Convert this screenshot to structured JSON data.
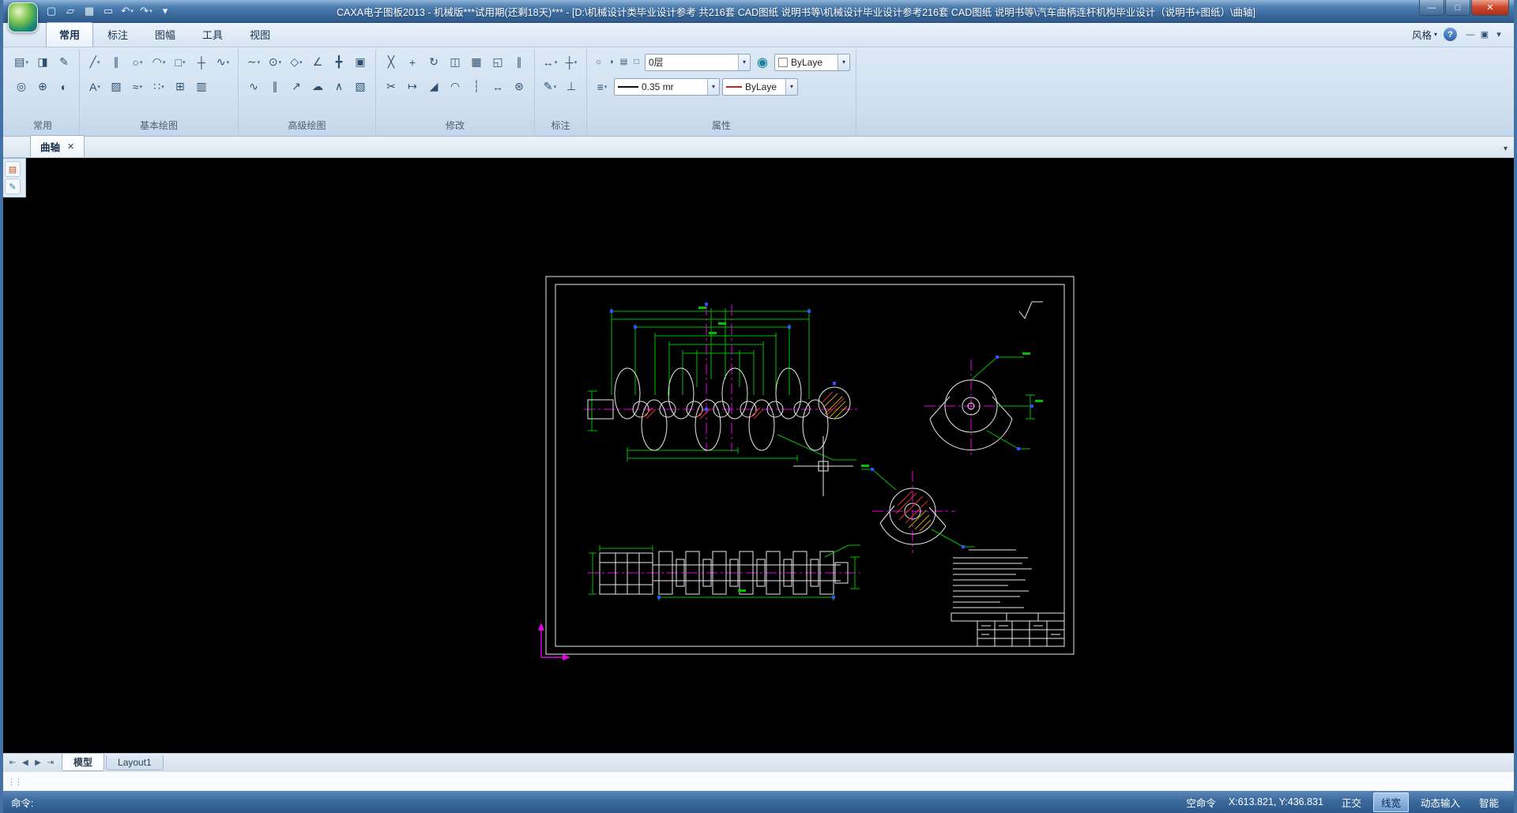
{
  "window": {
    "title": "CAXA电子图板2013 - 机械版***试用期(还剩18天)*** - [D:\\机械设计类毕业设计参考 共216套 CAD图纸 说明书等\\机械设计毕业设计参考216套 CAD图纸 说明书等\\汽车曲柄连杆机构毕业设计（说明书+图纸）\\曲轴]"
  },
  "icons": {
    "dd": "▾",
    "close": "✕",
    "chevron": "▾",
    "help": "?",
    "min": "—",
    "max": "□"
  },
  "titlebar": {
    "quick_access": [
      {
        "name": "new-file-icon",
        "glyph": "▢"
      },
      {
        "name": "open-file-icon",
        "glyph": "▱"
      },
      {
        "name": "save-icon",
        "glyph": "▦"
      },
      {
        "name": "print-icon",
        "glyph": "▭"
      },
      {
        "name": "undo-icon",
        "glyph": "↶",
        "dd": true
      },
      {
        "name": "redo-icon",
        "glyph": "↷",
        "dd": true
      },
      {
        "name": "qat-menu-icon",
        "glyph": "▾"
      }
    ]
  },
  "ribbon": {
    "tabs": [
      "常用",
      "标注",
      "图幅",
      "工具",
      "视图"
    ],
    "style_label": "风格",
    "right_icons": [
      {
        "name": "ribbon-minimize-icon",
        "glyph": "—"
      },
      {
        "name": "ribbon-window-icon",
        "glyph": "▣"
      },
      {
        "name": "ribbon-options-icon",
        "glyph": "▾"
      }
    ],
    "groups": [
      {
        "label": "常用",
        "row1": [
          {
            "name": "paste-icon",
            "glyph": "▤",
            "dd": true
          },
          {
            "name": "copy-icon",
            "glyph": "◨"
          },
          {
            "name": "format-painter-icon",
            "glyph": "✎"
          }
        ],
        "row2": [
          {
            "name": "zoom-icon",
            "glyph": "◎"
          },
          {
            "name": "pan-icon",
            "glyph": "⊕"
          },
          {
            "name": "redraw-icon",
            "glyph": "◐"
          }
        ]
      },
      {
        "label": "基本绘图",
        "row1": [
          {
            "name": "line-icon",
            "glyph": "╱",
            "dd": true
          },
          {
            "name": "parallel-line-icon",
            "glyph": "∥"
          },
          {
            "name": "circle-icon",
            "glyph": "○",
            "dd": true
          },
          {
            "name": "arc-icon",
            "glyph": "◠",
            "dd": true
          },
          {
            "name": "rectangle-icon",
            "glyph": "□",
            "dd": true
          },
          {
            "name": "centerline-icon",
            "glyph": "┼"
          },
          {
            "name": "polyline-icon",
            "glyph": "∿",
            "dd": true
          }
        ],
        "row2": [
          {
            "name": "text-icon",
            "glyph": "A",
            "dd": true
          },
          {
            "name": "hatch-icon",
            "glyph": "▨"
          },
          {
            "name": "spline-icon",
            "glyph": "≈",
            "dd": true
          },
          {
            "name": "point-icon",
            "glyph": "∷",
            "dd": true
          },
          {
            "name": "block-icon",
            "glyph": "⊞"
          },
          {
            "name": "table-icon",
            "glyph": "▥"
          }
        ]
      },
      {
        "label": "高级绘图",
        "row1": [
          {
            "name": "spline-curve-icon",
            "glyph": "∼",
            "dd": true
          },
          {
            "name": "ellipse-icon",
            "glyph": "⊙",
            "dd": true
          },
          {
            "name": "polygon-icon",
            "glyph": "◇",
            "dd": true
          },
          {
            "name": "angle-line-icon",
            "glyph": "∠"
          },
          {
            "name": "axis-icon",
            "glyph": "╋"
          },
          {
            "name": "ole-object-icon",
            "glyph": "▣"
          }
        ],
        "row2": [
          {
            "name": "wave-line-icon",
            "glyph": "∿"
          },
          {
            "name": "double-line-icon",
            "glyph": "∥"
          },
          {
            "name": "arrow-icon",
            "glyph": "↗"
          },
          {
            "name": "revision-cloud-icon",
            "glyph": "☁"
          },
          {
            "name": "zigzag-icon",
            "glyph": "∧"
          },
          {
            "name": "adv-hatch-icon",
            "glyph": "▧"
          }
        ]
      },
      {
        "label": "修改",
        "row1": [
          {
            "name": "erase-icon",
            "glyph": "╳"
          },
          {
            "name": "move-icon",
            "glyph": "+"
          },
          {
            "name": "rotate-icon",
            "glyph": "↻"
          },
          {
            "name": "mirror-icon",
            "glyph": "◫"
          },
          {
            "name": "array-icon",
            "glyph": "▦"
          },
          {
            "name": "scale-icon",
            "glyph": "◱"
          },
          {
            "name": "offset-icon",
            "glyph": "∥"
          }
        ],
        "row2": [
          {
            "name": "trim-icon",
            "glyph": "✂"
          },
          {
            "name": "extend-icon",
            "glyph": "↦"
          },
          {
            "name": "chamfer-icon",
            "glyph": "◢"
          },
          {
            "name": "fillet-icon",
            "glyph": "◠"
          },
          {
            "name": "break-icon",
            "glyph": "┆"
          },
          {
            "name": "stretch-icon",
            "glyph": "↔"
          },
          {
            "name": "explode-icon",
            "glyph": "⊛"
          }
        ]
      },
      {
        "label": "标注",
        "row1": [
          {
            "name": "dimension-icon",
            "glyph": "↔",
            "dd": true
          },
          {
            "name": "coordinate-dim-icon",
            "glyph": "┼",
            "dd": true
          }
        ],
        "row2": [
          {
            "name": "dim-style-icon",
            "glyph": "✎",
            "dd": true
          },
          {
            "name": "datum-icon",
            "glyph": "⊥"
          }
        ]
      },
      {
        "label": "属性"
      }
    ],
    "layer_icons": [
      {
        "name": "layer-on-icon",
        "glyph": "☼"
      },
      {
        "name": "layer-freeze-icon",
        "glyph": "◑"
      },
      {
        "name": "layer-lock-icon",
        "glyph": "▤"
      },
      {
        "name": "layer-plot-icon",
        "glyph": "□"
      }
    ],
    "globe_icon": [
      {
        "name": "color-picker-icon",
        "glyph": "◉",
        "cls": "globe"
      }
    ],
    "linetype_mgr_icon": [
      {
        "name": "linetype-manager-icon",
        "glyph": "≡",
        "dd": true
      }
    ]
  },
  "properties": {
    "layer": "0层",
    "color": "ByLaye",
    "linewidth": "0.35 mr",
    "linetype": "ByLaye"
  },
  "document": {
    "label": "曲轴"
  },
  "palette_icons": [
    {
      "name": "palette-properties-icon",
      "glyph": "▤",
      "cls": "p1"
    },
    {
      "name": "palette-library-icon",
      "glyph": "✎",
      "cls": "p2"
    }
  ],
  "sheet_nav": [
    {
      "name": "first-sheet-icon",
      "glyph": "⇤"
    },
    {
      "name": "prev-sheet-icon",
      "glyph": "◀"
    },
    {
      "name": "next-sheet-icon",
      "glyph": "▶"
    },
    {
      "name": "last-sheet-icon",
      "glyph": "⇥"
    }
  ],
  "sheet_tabs": [
    "模型",
    "Layout1"
  ],
  "status_bar": {
    "command_label": "命令:",
    "idle": "空命令",
    "coords": "X:613.821, Y:436.831",
    "toggles": [
      {
        "label": "正交",
        "active": false
      },
      {
        "label": "线宽",
        "active": true
      },
      {
        "label": "动态输入",
        "active": false
      },
      {
        "label": "智能",
        "active": false
      }
    ]
  },
  "colors": {
    "dimension": "#00c000",
    "centerline": "#e800e8",
    "outline": "#e8e8e8",
    "hatch_red": "#d83030",
    "hatch_yellow": "#c8a018",
    "grip_blue": "#3050ff",
    "canvas": "#000000"
  }
}
